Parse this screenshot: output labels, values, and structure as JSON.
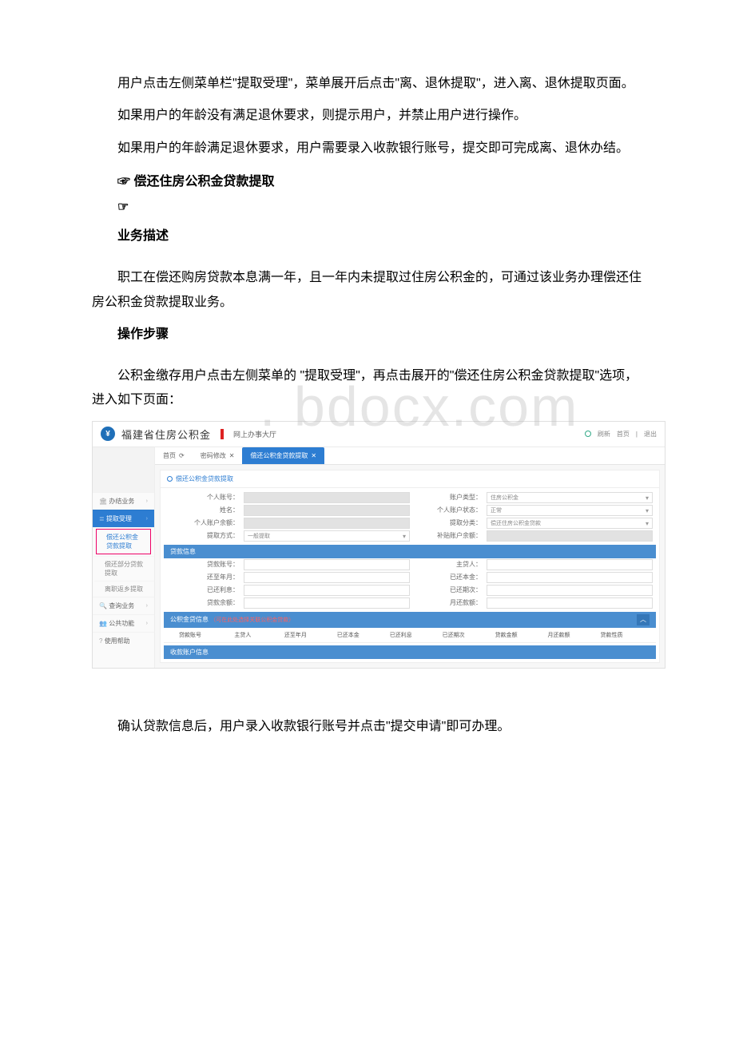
{
  "doc": {
    "p1": "用户点击左侧菜单栏\"提取受理\"，菜单展开后点击\"离、退休提取\"，进入离、退休提取页面。",
    "p2": "如果用户的年龄没有满足退休要求，则提示用户，并禁止用户进行操作。",
    "p3": "如果用户的年龄满足退休要求，用户需要录入收款银行账号，提交即可完成离、退休办结。",
    "s1": "☞ 偿还住房公积金贷款提取",
    "s1b": "☞",
    "h1": "业务描述",
    "p4": "职工在偿还购房贷款本息满一年，且一年内未提取过住房公积金的，可通过该业务办理偿还住房公积金贷款提取业务。",
    "h2": "操作步骤",
    "p5": "公积金缴存用户点击左侧菜单的 \"提取受理\"，再点击展开的\"偿还住房公积金贷款提取\"选项，进入如下页面：",
    "p6": "确认贷款信息后，用户录入收款银行账号并点击\"提交申请\"即可办理。",
    "watermark": ". bdocx.com"
  },
  "app": {
    "title": "福建省住房公积金",
    "subtitle": "网上办事大厅",
    "header_refresh": "刷新",
    "header_home": "首页",
    "header_logout": "退出",
    "tabs": [
      {
        "label": "首页",
        "close": true
      },
      {
        "label": "密码修改",
        "close": true
      },
      {
        "label": "偿还公积金贷款提取",
        "close": true,
        "active": true
      }
    ],
    "side": [
      {
        "label": "办结业务",
        "icon": "🏛",
        "chev": true
      },
      {
        "label": "提取受理",
        "icon": "≣",
        "chev": true,
        "active": true
      },
      {
        "sub": true,
        "label": "偿还公积金贷款提取",
        "current": true
      },
      {
        "sub": true,
        "label": "偿还部分贷款提取"
      },
      {
        "sub": true,
        "label": "离职返乡提取"
      },
      {
        "label": "查询业务",
        "icon": "🔍",
        "chev": true
      },
      {
        "label": "公共功能",
        "icon": "👥",
        "chev": true
      },
      {
        "label": "使用帮助",
        "icon": "?",
        "chev": false
      }
    ],
    "card_title": "偿还公积金贷款提取",
    "form": {
      "r1l_label": "个人账号：",
      "r1l_shade": true,
      "r1r_label": "账户类型：",
      "r1r_value": "住房公积金",
      "r2l_label": "姓名：",
      "r2l_shade": true,
      "r2r_label": "个人账户状态：",
      "r2r_value": "正常",
      "r3l_label": "个人账户余额：",
      "r3l_shade": true,
      "r3r_label": "提取分类：",
      "r3r_value": "偿还住房公积金贷款",
      "r4l_label": "提取方式：",
      "r4l_value": "一般提取",
      "r4r_label": "补贴账户余额：",
      "r4r_shade": true
    },
    "loan_seg": "贷款信息",
    "loan_form": {
      "c1l": "贷款账号：",
      "c1r": "主贷人：",
      "c2l": "还至年月：",
      "c2r": "已还本金：",
      "c3l": "已还利息：",
      "c3r": "已还期次：",
      "c4l": "贷款余额：",
      "c4r": "月还款额："
    },
    "loan_table_seg": "公积金贷信息",
    "loan_table_warn": "（可在此处选择关联公积金贷款）",
    "loan_table_head": [
      "贷款账号",
      "主贷人",
      "还至年月",
      "已还本金",
      "已还利息",
      "已还期次",
      "贷款金额",
      "月还款额",
      "贷款性质",
      ""
    ],
    "collect_seg": "收款账户信息",
    "collapse_glyph": "︿"
  }
}
